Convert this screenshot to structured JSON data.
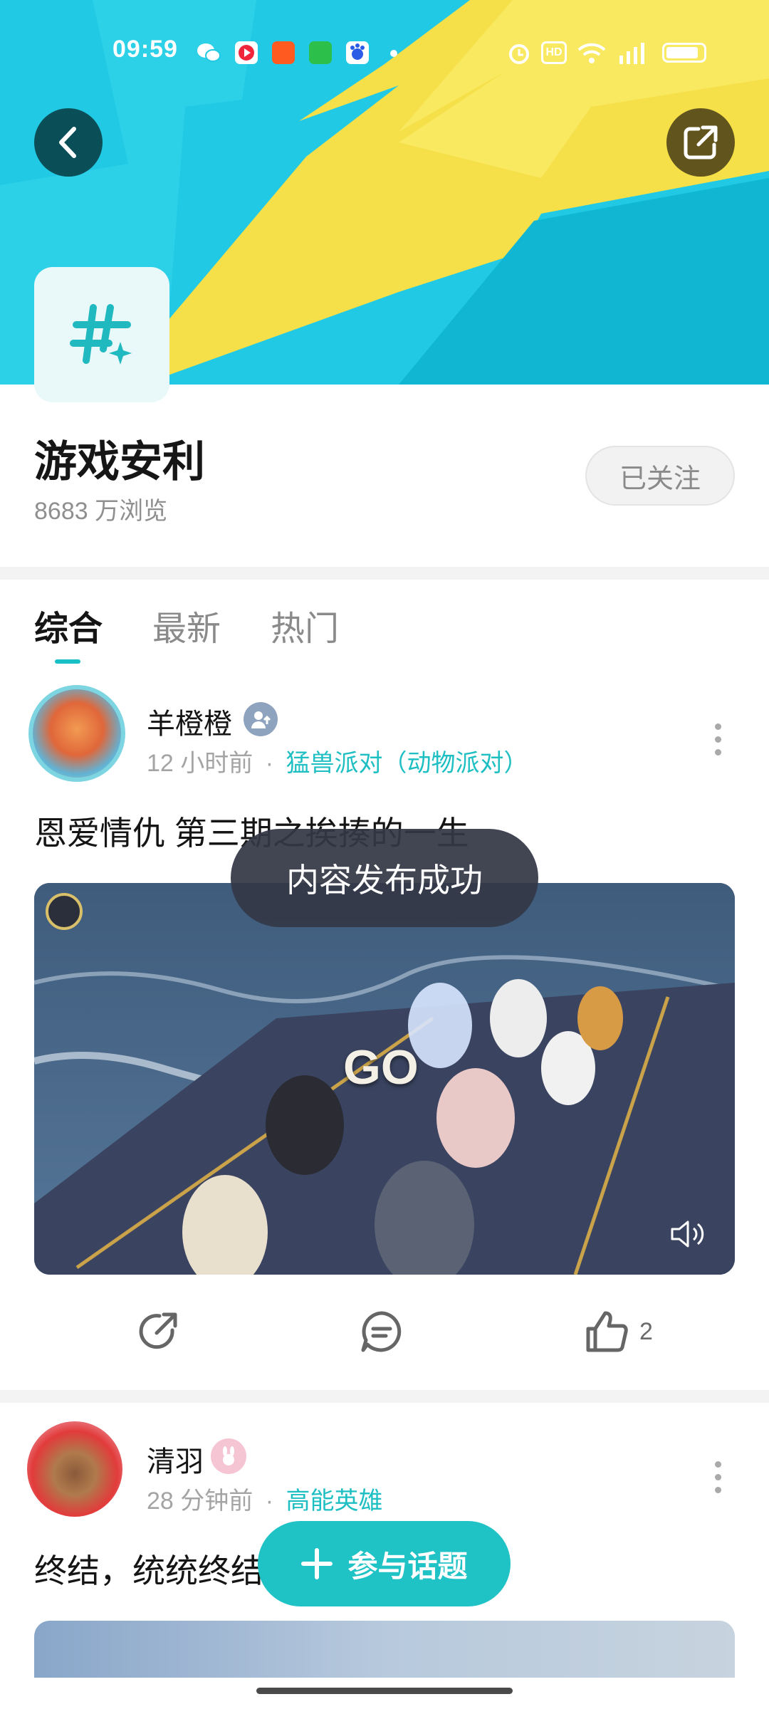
{
  "status_bar": {
    "time": "09:59",
    "icons": [
      "wechat-icon",
      "video-app-icon",
      "taobao-icon",
      "message-app-icon",
      "baidu-icon",
      "dot-icon",
      "alarm-icon",
      "hd-icon",
      "wifi-icon",
      "5g-signal-icon",
      "battery-icon"
    ]
  },
  "header": {
    "back_icon": "chevron-left-icon",
    "share_icon": "external-share-icon",
    "topic_icon": "hashtag-sparkle-icon"
  },
  "topic": {
    "title": "游戏安利",
    "views": "8683 万浏览",
    "follow_label": "已关注"
  },
  "tabs": [
    {
      "label": "综合",
      "active": true
    },
    {
      "label": "最新",
      "active": false
    },
    {
      "label": "热门",
      "active": false
    }
  ],
  "posts": [
    {
      "user": "羊橙橙",
      "badge_icon": "user-upload-badge-icon",
      "time": "12 小时前",
      "sep": "·",
      "game": "猛兽派对（动物派对）",
      "text": "恩爱情仇 第三期之挨揍的一生",
      "video_overlay": "GO",
      "actions": {
        "share_icon": "share-icon",
        "comment_icon": "comment-icon",
        "like_icon": "thumbs-up-icon",
        "likes": "2"
      }
    },
    {
      "user": "清羽",
      "badge_icon": "rabbit-badge-icon",
      "time": "28 分钟前",
      "sep": "·",
      "game": "高能英雄",
      "text": "终结，统统终结"
    }
  ],
  "toast": "内容发布成功",
  "join_button": "参与话题",
  "colors": {
    "accent": "#1fc3c6",
    "banner_cyan": "#22c6de",
    "banner_yellow": "#f7e24c"
  }
}
